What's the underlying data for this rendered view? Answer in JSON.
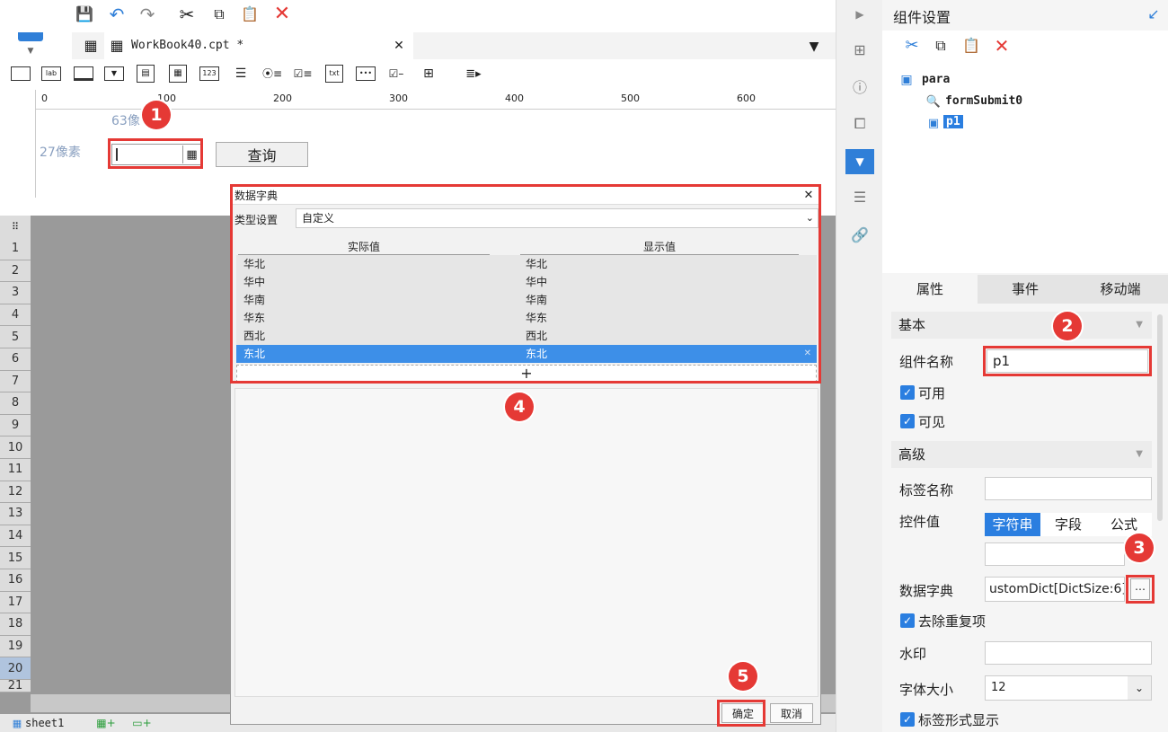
{
  "tabs": {
    "workbook": "WorkBook40.cpt *",
    "sheet": "sheet1"
  },
  "ruler": {
    "marks": [
      "0",
      "100",
      "200",
      "300",
      "400",
      "500",
      "600"
    ]
  },
  "canvas": {
    "width_label": "63像",
    "height_label": "27像素",
    "query_button": "查询"
  },
  "grid": {
    "rows": [
      "1",
      "2",
      "3",
      "4",
      "5",
      "6",
      "7",
      "8",
      "9",
      "10",
      "11",
      "12",
      "13",
      "14",
      "15",
      "16",
      "17",
      "18",
      "19",
      "20",
      "21"
    ]
  },
  "dialog": {
    "title": "数据字典",
    "type_label": "类型设置",
    "type_value": "自定义",
    "col_actual": "实际值",
    "col_display": "显示值",
    "rows": [
      {
        "actual": "华北",
        "display": "华北"
      },
      {
        "actual": "华中",
        "display": "华中"
      },
      {
        "actual": "华南",
        "display": "华南"
      },
      {
        "actual": "华东",
        "display": "华东"
      },
      {
        "actual": "西北",
        "display": "西北"
      },
      {
        "actual": "东北",
        "display": "东北"
      }
    ],
    "add": "+",
    "ok": "确定",
    "cancel": "取消"
  },
  "panel": {
    "title": "组件设置",
    "tree": {
      "root": "para",
      "child1": "formSubmit0",
      "child2": "p1"
    },
    "tabs": {
      "props": "属性",
      "events": "事件",
      "mobile": "移动端"
    },
    "basic": "基本",
    "name_label": "组件名称",
    "name_value": "p1",
    "enabled": "可用",
    "visible": "可见",
    "advanced": "高级",
    "tag_label": "标签名称",
    "ctrl_value": "控件值",
    "ctrl_tabs": {
      "string": "字符串",
      "field": "字段",
      "formula": "公式"
    },
    "dict_label": "数据字典",
    "dict_value": "ustomDict[DictSize:6]",
    "dedupe": "去除重复项",
    "watermark": "水印",
    "font_size_label": "字体大小",
    "font_size_value": "12",
    "label_display": "标签形式显示"
  },
  "badges": [
    "1",
    "2",
    "3",
    "4",
    "5"
  ],
  "colors": {
    "accent": "#e53935",
    "select": "#3d8fe8",
    "primary": "#2a7ee0"
  }
}
